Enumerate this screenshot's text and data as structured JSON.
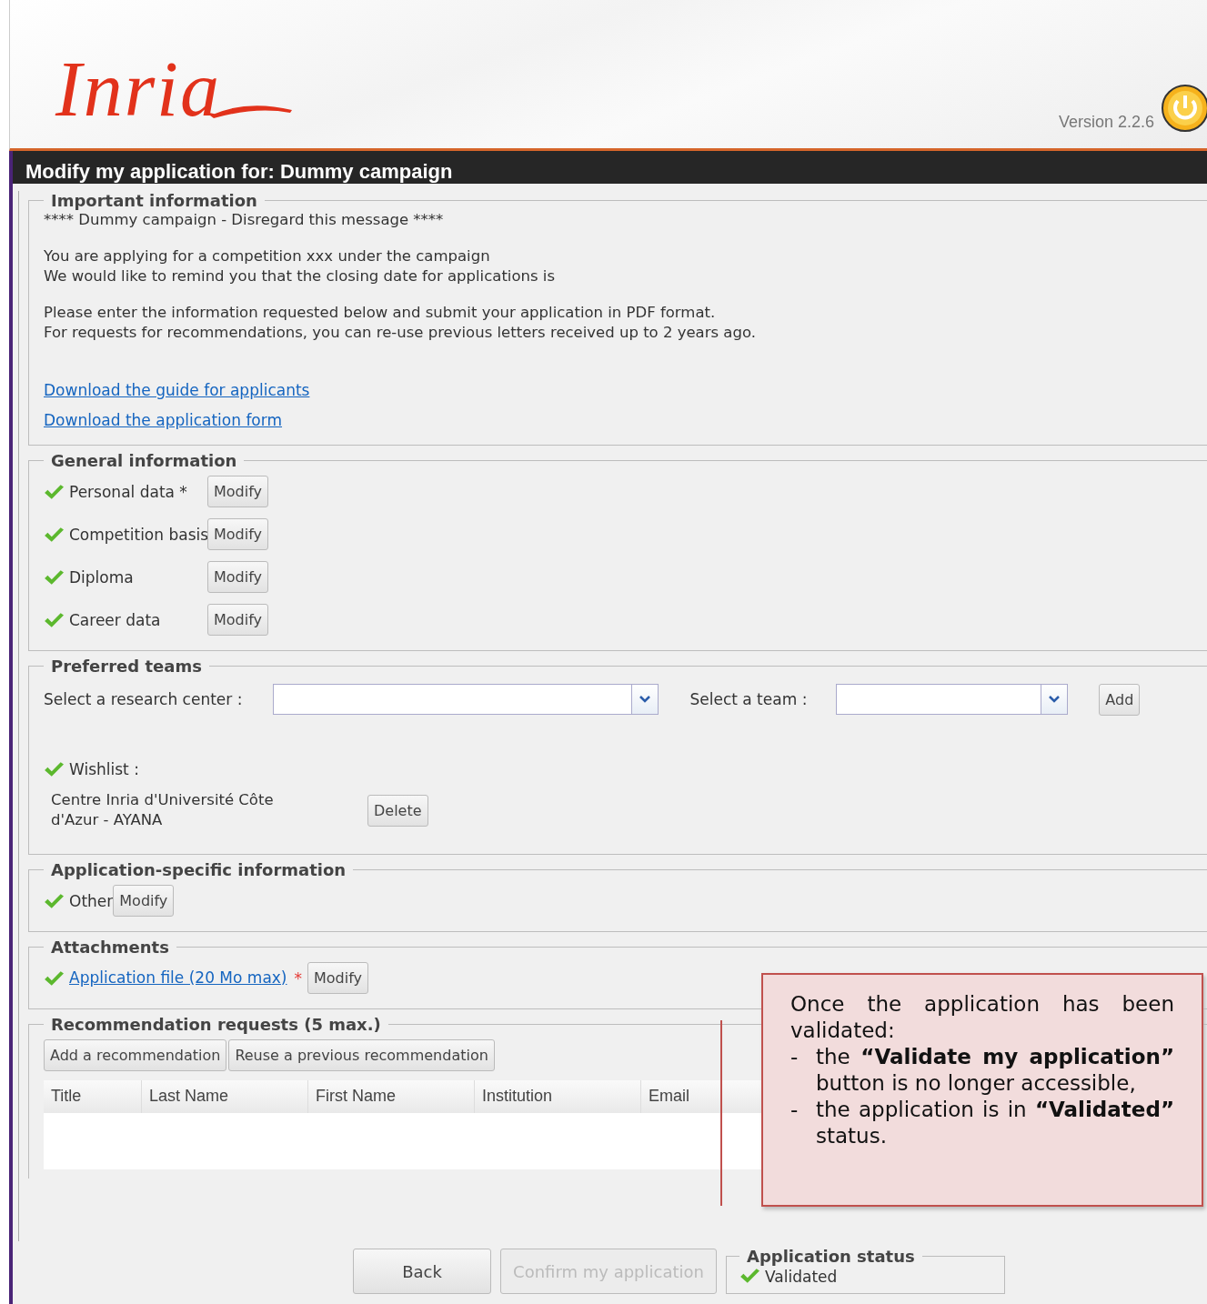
{
  "header": {
    "logo": "Inria",
    "version": "Version 2.2.6"
  },
  "page_title": "Modify my application for: Dummy campaign",
  "important": {
    "legend": "Important information",
    "paragraphs": [
      [
        "**** Dummy campaign - Disregard this message ****"
      ],
      [
        "You are applying for a competition xxx under the campaign",
        "We would like to remind you that the closing date for applications is"
      ],
      [
        "Please enter the information requested below and submit your application in PDF format.",
        "For requests for recommendations, you can re-use previous letters received up to 2 years ago."
      ]
    ],
    "links": [
      "Download the guide for applicants",
      "Download the application form"
    ]
  },
  "general": {
    "legend": "General information",
    "items": [
      {
        "label": "Personal data *",
        "checked": true,
        "button": "Modify"
      },
      {
        "label": "Competition basis",
        "checked": true,
        "button": "Modify"
      },
      {
        "label": "Diploma",
        "checked": true,
        "button": "Modify"
      },
      {
        "label": "Career data",
        "checked": true,
        "button": "Modify"
      }
    ]
  },
  "teams": {
    "legend": "Preferred teams",
    "center_label": "Select a research center :",
    "team_label": "Select a team :",
    "add_button": "Add",
    "wishlist": {
      "label": "Wishlist :",
      "checked": true
    },
    "entries": [
      {
        "name": "Centre Inria d'Université Côte d'Azur - AYANA",
        "button": "Delete"
      }
    ]
  },
  "specific": {
    "legend": "Application-specific information",
    "items": [
      {
        "label": "Other",
        "checked": true,
        "button": "Modify"
      }
    ]
  },
  "attachments": {
    "legend": "Attachments",
    "items": [
      {
        "label": "Application file (20 Mo max)",
        "required_mark": "*",
        "checked": true,
        "button": "Modify"
      }
    ]
  },
  "recommendations": {
    "legend": "Recommendation requests (5 max.)",
    "buttons": [
      "Add a recommendation",
      "Reuse a previous recommendation"
    ],
    "columns": [
      "Title",
      "Last Name",
      "First Name",
      "Institution",
      "Email"
    ]
  },
  "footer": {
    "back": "Back",
    "confirm": {
      "label": "Confirm my application",
      "disabled": true
    },
    "status": {
      "legend": "Application status",
      "value": "Validated",
      "checked": true
    }
  },
  "callout": {
    "intro": "Once the application has been validated:",
    "bullets": [
      {
        "marker": "-",
        "text": "the **“Validate my application”** button is no longer accessible,"
      },
      {
        "marker": "-",
        "text": "the application is in **“Validated”** status."
      }
    ]
  }
}
